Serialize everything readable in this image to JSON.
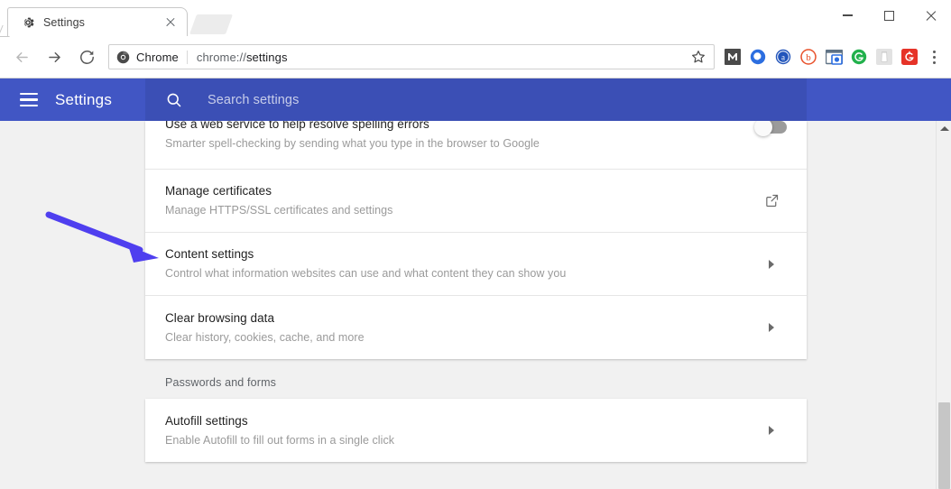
{
  "window": {
    "controls": {
      "minimize": "minimize-button",
      "maximize": "maximize-button",
      "close": "close-button"
    }
  },
  "tabs": [
    {
      "title": "Settings",
      "favicon": "gear-icon",
      "active": true
    }
  ],
  "newtab": {
    "label": "New tab"
  },
  "toolbar": {
    "back": "back-arrow-icon",
    "forward": "forward-arrow-icon",
    "reload": "reload-icon",
    "omnibox": {
      "chip_label": "Chrome",
      "chip_icon": "chrome-logo-icon",
      "url_scheme": "chrome://",
      "url_path": "settings",
      "url_full": "chrome://settings",
      "star": "bookmark-star-icon"
    },
    "extensions": [
      {
        "name": "mailtrack-extension",
        "glyph": "M",
        "bg": "#4a4a4a",
        "fg": "#ffffff"
      },
      {
        "name": "q-extension",
        "glyph": "Q",
        "bg": "#2c6ee0",
        "fg": "#ffffff"
      },
      {
        "name": "a-extension",
        "glyph": "a",
        "bg": "#2255bb",
        "fg": "#ffffff"
      },
      {
        "name": "b-extension",
        "glyph": "b",
        "bg": "#e8502a",
        "fg": "#ffffff"
      },
      {
        "name": "screenshot-extension",
        "glyph": "camera",
        "bg": "#5f7285",
        "fg": "#ffffff"
      },
      {
        "name": "grammarly-extension",
        "glyph": "G",
        "bg": "#22b14c",
        "fg": "#ffffff"
      },
      {
        "name": "notes-extension",
        "glyph": "note",
        "bg": "#d8d8d8",
        "fg": "#ffffff"
      },
      {
        "name": "g-extension",
        "glyph": "G",
        "bg": "#e63328",
        "fg": "#ffffff"
      }
    ],
    "menu": "three-dot-menu-icon"
  },
  "settings_header": {
    "menu_icon": "hamburger-menu-icon",
    "title": "Settings",
    "search": {
      "icon": "search-icon",
      "placeholder": "Search settings",
      "value": ""
    },
    "bg_color": "#4156c4",
    "search_bg_color": "#3b4fb5"
  },
  "main": {
    "privacy_card": {
      "rows": [
        {
          "title": "Use a web service to help resolve spelling errors",
          "sub": "Smarter spell-checking by sending what you type in the browser to Google",
          "action": "toggle",
          "toggle_on": false,
          "clipped": true
        },
        {
          "title": "Manage certificates",
          "sub": "Manage HTTPS/SSL certificates and settings",
          "action": "external-link",
          "toggle_on": null,
          "clipped": false
        },
        {
          "title": "Content settings",
          "sub": "Control what information websites can use and what content they can show you",
          "action": "chevron",
          "toggle_on": null,
          "clipped": false
        },
        {
          "title": "Clear browsing data",
          "sub": "Clear history, cookies, cache, and more",
          "action": "chevron",
          "toggle_on": null,
          "clipped": false
        }
      ]
    },
    "passwords_section": {
      "label": "Passwords and forms",
      "rows": [
        {
          "title": "Autofill settings",
          "sub": "Enable Autofill to fill out forms in a single click",
          "action": "chevron"
        }
      ]
    }
  },
  "annotation": {
    "name": "pointer-arrow",
    "color": "#4f3fef",
    "points_to": "Content settings"
  },
  "scrollbar": {
    "up_arrow": "scroll-up-arrow-icon",
    "thumb": "scrollbar-thumb"
  }
}
